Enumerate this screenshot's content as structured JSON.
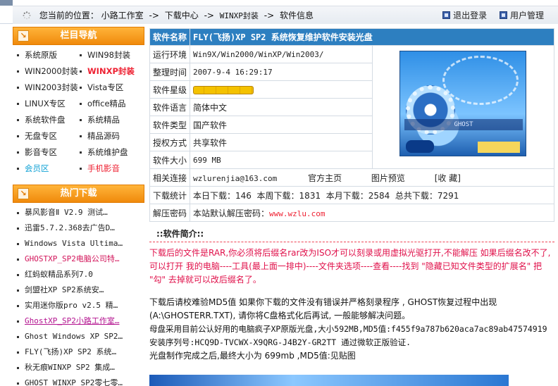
{
  "breadcrumb": {
    "prefix": "您当前的位置：",
    "items": [
      "小路工作室",
      "下载中心",
      "WINXP封装",
      "软件信息"
    ],
    "sep": "->"
  },
  "top_links": {
    "logout": "退出登录",
    "user_admin": "用户管理"
  },
  "nav_panel": {
    "title": "栏目导航",
    "rows": [
      [
        "系统原版",
        "WIN98封装"
      ],
      [
        "WIN2000封装",
        "WINXP封装"
      ],
      [
        "WIN2003封装",
        "Vista专区"
      ],
      [
        "LINUX专区",
        "office精品"
      ],
      [
        "系统软件盘",
        "系统精品"
      ],
      [
        "无盘专区",
        "精品源码"
      ],
      [
        "影音专区",
        "系统维护盘"
      ],
      [
        "会员区",
        "手机影音"
      ]
    ]
  },
  "hot_panel": {
    "title": "热门下载",
    "items": [
      "暴风影音Ⅱ V2.9 测试…",
      "迅雷5.7.2.368去广告D…",
      "Windows Vista Ultima…",
      "GHOSTXP_SP2电脑公司特…",
      "红蚂蚁精品系列7.0",
      "剑盟社XP SP2系统安…",
      "实用迷你版pro v2.5 精…",
      "GhostXP_SP2小路工作室…",
      "Ghost Windows XP SP2…",
      "FLY(飞扬)XP SP2 系统…",
      "秋无痕WINXP SP2 集成…",
      "GHOST WINXP_SP2零七零…"
    ]
  },
  "info": {
    "name_label": "软件名称",
    "name_value": "FLY(飞扬)XP SP2 系统恢复维护软件安装光盘",
    "env_label": "运行环境",
    "env_value": "Win9X/Win2000/WinXP/Win2003/",
    "time_label": "整理时间",
    "time_value": "2007-9-4 16:29:17",
    "stars_label": "软件星级",
    "stars_value": 5,
    "lang_label": "软件语言",
    "lang_value": "简体中文",
    "type_label": "软件类型",
    "type_value": "国产软件",
    "license_label": "授权方式",
    "license_value": "共享软件",
    "size_label": "软件大小",
    "size_value": "699 MB",
    "related_label": "相关连接",
    "related_email": "wzlurenjia@163.com",
    "related_home": "官方主页",
    "related_preview": "图片预览",
    "related_fav": "[收 藏]",
    "stats_label": "下载统计",
    "stats_value": "本日下载：146  本周下载：1831  本月下载：2584  总共下载：7291",
    "unzip_label": "解压密码",
    "unzip_value": "本站默认解压密码：",
    "unzip_site": "www.wzlu.com"
  },
  "intro": {
    "heading": "::软件简介::",
    "red_text": "下载后的文件是RAR,你必须将后缀名rar改为ISO才可以刻录或用虚拟光驱打开,不能解压 如果后缀名改不了,可以打开  我的电脑----工具(最上面一排中)----文件夹选项----查看----找到 \"隐藏已知文件类型的扩展名\" 把 \"勾\" 去掉就可以改后缀名了。",
    "para1": "下载后请校难验MD5值  如果你下载的文件没有错误并严格刻录程序 , GHOST恢复过程中出现(A:\\GHOSTERR.TXT), 请你将C盘格式化后再试, 一般能够解决问题。",
    "para2": "母盘采用目前公认好用的电脑疯子XP原版光盘,大小592MB,MD5值:f455f9a787b620aca7ac89ab47574919",
    "para3": "安装序列号:HCQ9D-TVCWX-X9QRG-J4B2Y-GR2TT  通过微软正版验证.",
    "para4": "光盘制作完成之后,最终大小为 699mb ,MD5值:见贴图"
  },
  "colors": {
    "title_blue": "#2d7fc0",
    "orange_head": "#f08a0b",
    "accent_red": "#e23"
  }
}
